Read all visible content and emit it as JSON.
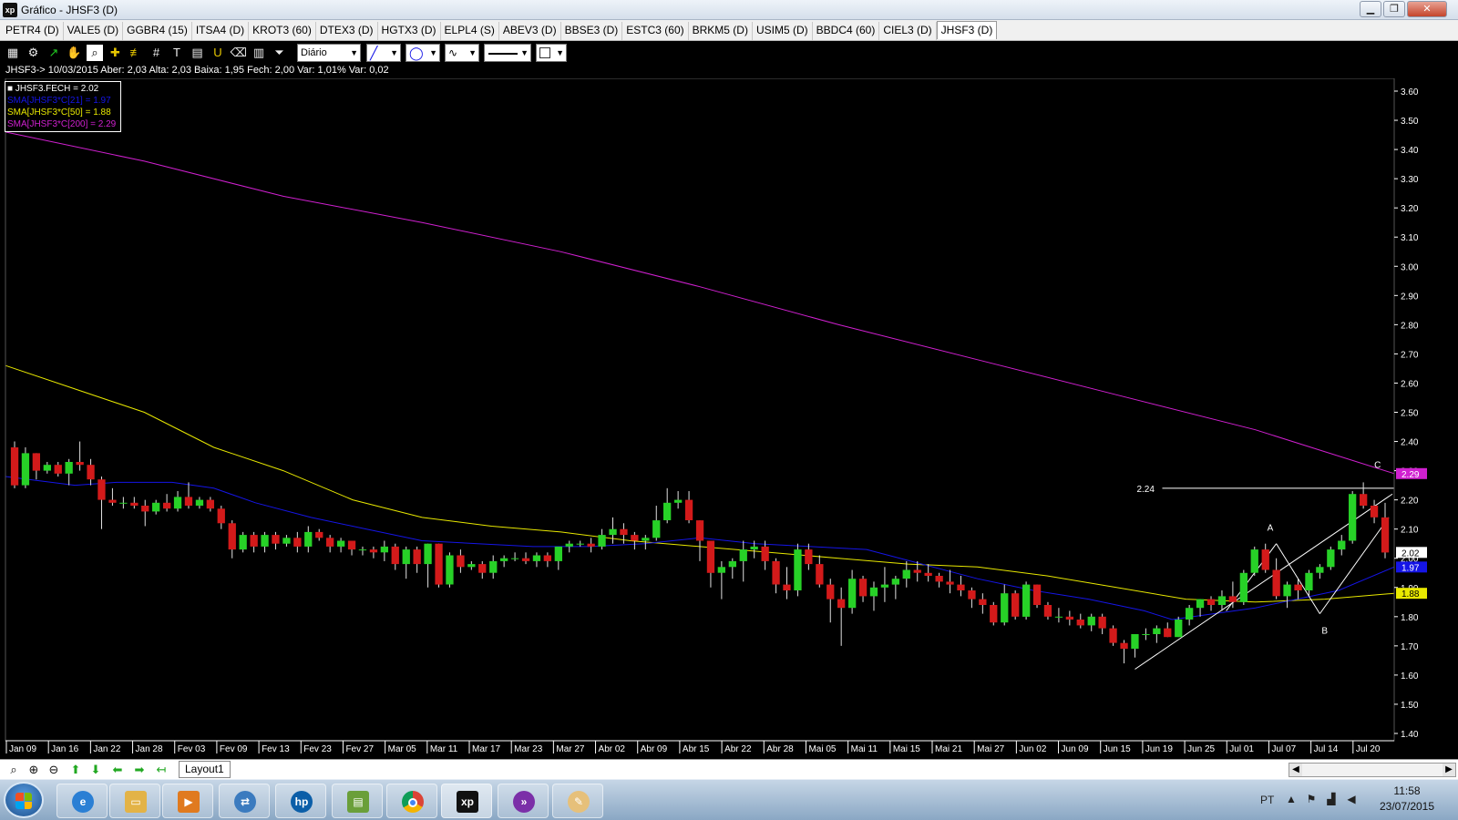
{
  "window": {
    "logo": "xp",
    "title": "Gráfico - JHSF3 (D)",
    "controls": [
      "▁",
      "❐",
      "✕"
    ]
  },
  "tabs": [
    {
      "label": "PETR4 (D)"
    },
    {
      "label": "VALE5 (D)"
    },
    {
      "label": "GGBR4 (15)"
    },
    {
      "label": "ITSA4 (D)"
    },
    {
      "label": "KROT3 (60)"
    },
    {
      "label": "DTEX3 (D)"
    },
    {
      "label": "HGTX3 (D)"
    },
    {
      "label": "ELPL4 (S)"
    },
    {
      "label": "ABEV3 (D)"
    },
    {
      "label": "BBSE3 (D)"
    },
    {
      "label": "ESTC3 (60)"
    },
    {
      "label": "BRKM5 (D)"
    },
    {
      "label": "USIM5 (D)"
    },
    {
      "label": "BBDC4 (60)"
    },
    {
      "label": "CIEL3 (D)"
    },
    {
      "label": "JHSF3 (D)",
      "active": true
    }
  ],
  "toolbar": {
    "icons": [
      "chart-icon",
      "gear-icon",
      "line-tool-icon",
      "hand-icon",
      "zoom-fit-icon",
      "crosshair-icon",
      "parallel-lines-icon",
      "grid-icon",
      "text-icon",
      "calculator-icon",
      "magnet-icon",
      "eraser-icon",
      "trash-icon",
      "filter-icon"
    ],
    "period": "Diário"
  },
  "info": {
    "line": "JHSF3-> 10/03/2015 Aber: 2,03 Alta: 2,03 Baixa: 1,95 Fech: 2,00 Var: 1,01% Var: 0,02"
  },
  "legend": [
    {
      "text": "JHSF3.FECH = 2.02",
      "color": "#ffffff"
    },
    {
      "text": "SMA[JHSF3*C[21] = 1.97",
      "color": "#1515e6"
    },
    {
      "text": "SMA[JHSF3*C[50] = 1.88",
      "color": "#e8e800"
    },
    {
      "text": "SMA[JHSF3*C[200] = 2.29",
      "color": "#d020d0"
    }
  ],
  "chart_data": {
    "type": "candlestick",
    "ylim": [
      1.4,
      3.66
    ],
    "y_ticks": [
      "3.60",
      "3.50",
      "3.40",
      "3.30",
      "3.20",
      "3.10",
      "3.00",
      "2.90",
      "2.80",
      "2.70",
      "2.60",
      "2.50",
      "2.40",
      "2.30",
      "2.20",
      "2.10",
      "2.00",
      "1.90",
      "1.80",
      "1.70",
      "1.60",
      "1.50",
      "1.40"
    ],
    "x_labels": [
      "Jan 09",
      "Jan 16",
      "Jan 22",
      "Jan 28",
      "Fev 03",
      "Fev 09",
      "Fev 13",
      "Fev 23",
      "Fev 27",
      "Mar 05",
      "Mar 11",
      "Mar 17",
      "Mar 23",
      "Mar 27",
      "Abr 02",
      "Abr 09",
      "Abr 15",
      "Abr 22",
      "Abr 28",
      "Mai 05",
      "Mai 11",
      "Mai 15",
      "Mai 21",
      "Mai 27",
      "Jun 02",
      "Jun 09",
      "Jun 15",
      "Jun 19",
      "Jun 25",
      "Jul 01",
      "Jul 07",
      "Jul 14",
      "Jul 20"
    ],
    "candles": [
      [
        2.38,
        2.4,
        2.24,
        2.25
      ],
      [
        2.25,
        2.38,
        2.24,
        2.36
      ],
      [
        2.36,
        2.36,
        2.27,
        2.3
      ],
      [
        2.3,
        2.33,
        2.29,
        2.32
      ],
      [
        2.32,
        2.33,
        2.28,
        2.29
      ],
      [
        2.29,
        2.34,
        2.25,
        2.33
      ],
      [
        2.33,
        2.4,
        2.3,
        2.32
      ],
      [
        2.32,
        2.34,
        2.25,
        2.27
      ],
      [
        2.27,
        2.28,
        2.1,
        2.2
      ],
      [
        2.2,
        2.24,
        2.18,
        2.19
      ],
      [
        2.19,
        2.21,
        2.17,
        2.19
      ],
      [
        2.19,
        2.21,
        2.17,
        2.18
      ],
      [
        2.18,
        2.2,
        2.11,
        2.16
      ],
      [
        2.16,
        2.2,
        2.15,
        2.19
      ],
      [
        2.19,
        2.22,
        2.16,
        2.17
      ],
      [
        2.17,
        2.23,
        2.16,
        2.21
      ],
      [
        2.21,
        2.26,
        2.17,
        2.18
      ],
      [
        2.18,
        2.21,
        2.17,
        2.2
      ],
      [
        2.2,
        2.21,
        2.16,
        2.17
      ],
      [
        2.17,
        2.18,
        2.1,
        2.12
      ],
      [
        2.12,
        2.13,
        2.0,
        2.03
      ],
      [
        2.03,
        2.09,
        2.02,
        2.08
      ],
      [
        2.08,
        2.09,
        2.02,
        2.04
      ],
      [
        2.04,
        2.09,
        2.02,
        2.08
      ],
      [
        2.08,
        2.09,
        2.03,
        2.05
      ],
      [
        2.05,
        2.08,
        2.04,
        2.07
      ],
      [
        2.07,
        2.09,
        2.02,
        2.04
      ],
      [
        2.04,
        2.11,
        2.02,
        2.09
      ],
      [
        2.09,
        2.1,
        2.06,
        2.07
      ],
      [
        2.07,
        2.08,
        2.02,
        2.04
      ],
      [
        2.04,
        2.07,
        2.02,
        2.06
      ],
      [
        2.06,
        2.06,
        2.01,
        2.03
      ],
      [
        2.03,
        2.04,
        2.01,
        2.03
      ],
      [
        2.03,
        2.04,
        2.0,
        2.02
      ],
      [
        2.02,
        2.06,
        1.99,
        2.04
      ],
      [
        2.04,
        2.05,
        1.96,
        1.98
      ],
      [
        1.98,
        2.04,
        1.93,
        2.03
      ],
      [
        2.03,
        2.04,
        1.95,
        1.98
      ],
      [
        1.98,
        2.05,
        1.9,
        2.05
      ],
      [
        2.05,
        2.05,
        1.9,
        1.91
      ],
      [
        1.91,
        2.02,
        1.9,
        2.01
      ],
      [
        2.01,
        2.03,
        1.95,
        1.97
      ],
      [
        1.97,
        1.99,
        1.96,
        1.98
      ],
      [
        1.98,
        1.99,
        1.93,
        1.95
      ],
      [
        1.95,
        2.01,
        1.93,
        1.99
      ],
      [
        1.99,
        2.01,
        1.97,
        2.0
      ],
      [
        2.0,
        2.02,
        1.99,
        2.0
      ],
      [
        2.0,
        2.02,
        1.98,
        1.99
      ],
      [
        1.99,
        2.02,
        1.97,
        2.01
      ],
      [
        2.01,
        2.02,
        1.97,
        1.99
      ],
      [
        1.99,
        2.02,
        1.96,
        2.04
      ],
      [
        2.04,
        2.06,
        2.02,
        2.05
      ],
      [
        2.05,
        2.06,
        2.04,
        2.05
      ],
      [
        2.05,
        2.07,
        2.02,
        2.04
      ],
      [
        2.04,
        2.1,
        2.03,
        2.08
      ],
      [
        2.08,
        2.14,
        2.05,
        2.1
      ],
      [
        2.1,
        2.12,
        2.05,
        2.08
      ],
      [
        2.08,
        2.09,
        2.03,
        2.06
      ],
      [
        2.06,
        2.08,
        2.03,
        2.07
      ],
      [
        2.07,
        2.18,
        2.06,
        2.13
      ],
      [
        2.13,
        2.24,
        2.12,
        2.19
      ],
      [
        2.19,
        2.23,
        2.17,
        2.2
      ],
      [
        2.2,
        2.23,
        2.12,
        2.13
      ],
      [
        2.13,
        2.13,
        1.99,
        2.06
      ],
      [
        2.06,
        2.06,
        1.9,
        1.95
      ],
      [
        1.95,
        1.99,
        1.86,
        1.97
      ],
      [
        1.97,
        2.0,
        1.93,
        1.99
      ],
      [
        1.99,
        2.06,
        1.92,
        2.03
      ],
      [
        2.03,
        2.06,
        2.0,
        2.04
      ],
      [
        2.04,
        2.06,
        1.96,
        1.99
      ],
      [
        1.99,
        2.0,
        1.88,
        1.91
      ],
      [
        1.91,
        1.97,
        1.86,
        1.89
      ],
      [
        1.89,
        2.05,
        1.87,
        2.03
      ],
      [
        2.03,
        2.05,
        1.96,
        1.98
      ],
      [
        1.98,
        2.01,
        1.9,
        1.91
      ],
      [
        1.91,
        1.93,
        1.78,
        1.86
      ],
      [
        1.86,
        1.9,
        1.7,
        1.83
      ],
      [
        1.83,
        1.96,
        1.81,
        1.93
      ],
      [
        1.93,
        1.94,
        1.85,
        1.87
      ],
      [
        1.87,
        1.92,
        1.82,
        1.9
      ],
      [
        1.9,
        1.97,
        1.85,
        1.91
      ],
      [
        1.91,
        1.94,
        1.86,
        1.93
      ],
      [
        1.93,
        1.99,
        1.9,
        1.96
      ],
      [
        1.96,
        1.99,
        1.92,
        1.95
      ],
      [
        1.95,
        1.98,
        1.92,
        1.94
      ],
      [
        1.94,
        1.95,
        1.9,
        1.92
      ],
      [
        1.92,
        1.96,
        1.88,
        1.91
      ],
      [
        1.91,
        1.94,
        1.87,
        1.89
      ],
      [
        1.89,
        1.9,
        1.83,
        1.86
      ],
      [
        1.86,
        1.88,
        1.81,
        1.84
      ],
      [
        1.84,
        1.85,
        1.77,
        1.78
      ],
      [
        1.78,
        1.91,
        1.77,
        1.88
      ],
      [
        1.88,
        1.89,
        1.79,
        1.8
      ],
      [
        1.8,
        1.92,
        1.79,
        1.91
      ],
      [
        1.91,
        1.91,
        1.83,
        1.84
      ],
      [
        1.84,
        1.85,
        1.79,
        1.8
      ],
      [
        1.8,
        1.83,
        1.78,
        1.8
      ],
      [
        1.8,
        1.82,
        1.77,
        1.79
      ],
      [
        1.79,
        1.81,
        1.76,
        1.77
      ],
      [
        1.77,
        1.81,
        1.75,
        1.8
      ],
      [
        1.8,
        1.81,
        1.74,
        1.76
      ],
      [
        1.76,
        1.77,
        1.7,
        1.71
      ],
      [
        1.71,
        1.72,
        1.64,
        1.69
      ],
      [
        1.69,
        1.74,
        1.66,
        1.74
      ],
      [
        1.74,
        1.76,
        1.72,
        1.74
      ],
      [
        1.74,
        1.77,
        1.71,
        1.76
      ],
      [
        1.76,
        1.78,
        1.73,
        1.73
      ],
      [
        1.73,
        1.8,
        1.73,
        1.79
      ],
      [
        1.79,
        1.84,
        1.77,
        1.83
      ],
      [
        1.83,
        1.86,
        1.8,
        1.86
      ],
      [
        1.86,
        1.87,
        1.82,
        1.84
      ],
      [
        1.84,
        1.89,
        1.82,
        1.87
      ],
      [
        1.87,
        1.92,
        1.83,
        1.85
      ],
      [
        1.85,
        1.96,
        1.84,
        1.95
      ],
      [
        1.95,
        2.04,
        1.94,
        2.03
      ],
      [
        2.03,
        2.05,
        1.95,
        1.96
      ],
      [
        1.96,
        2.0,
        1.86,
        1.87
      ],
      [
        1.87,
        1.92,
        1.83,
        1.91
      ],
      [
        1.91,
        1.93,
        1.86,
        1.89
      ],
      [
        1.89,
        1.96,
        1.87,
        1.95
      ],
      [
        1.95,
        1.98,
        1.93,
        1.97
      ],
      [
        1.97,
        2.04,
        1.96,
        2.03
      ],
      [
        2.03,
        2.08,
        2.01,
        2.06
      ],
      [
        2.06,
        2.23,
        2.05,
        2.22
      ],
      [
        2.22,
        2.26,
        2.17,
        2.18
      ],
      [
        2.18,
        2.2,
        2.12,
        2.14
      ],
      [
        2.14,
        2.19,
        2.0,
        2.02
      ]
    ],
    "sma200": [
      [
        0,
        3.46
      ],
      [
        0.1,
        3.36
      ],
      [
        0.2,
        3.24
      ],
      [
        0.3,
        3.15
      ],
      [
        0.4,
        3.05
      ],
      [
        0.5,
        2.93
      ],
      [
        0.6,
        2.8
      ],
      [
        0.7,
        2.68
      ],
      [
        0.8,
        2.56
      ],
      [
        0.9,
        2.44
      ],
      [
        1.0,
        2.29
      ]
    ],
    "sma50": [
      [
        0,
        2.66
      ],
      [
        0.05,
        2.58
      ],
      [
        0.1,
        2.5
      ],
      [
        0.15,
        2.38
      ],
      [
        0.2,
        2.3
      ],
      [
        0.25,
        2.2
      ],
      [
        0.3,
        2.14
      ],
      [
        0.35,
        2.11
      ],
      [
        0.4,
        2.09
      ],
      [
        0.45,
        2.06
      ],
      [
        0.5,
        2.04
      ],
      [
        0.55,
        2.02
      ],
      [
        0.6,
        2.0
      ],
      [
        0.65,
        1.98
      ],
      [
        0.7,
        1.97
      ],
      [
        0.75,
        1.94
      ],
      [
        0.8,
        1.9
      ],
      [
        0.85,
        1.86
      ],
      [
        0.9,
        1.85
      ],
      [
        0.95,
        1.86
      ],
      [
        1.0,
        1.88
      ]
    ],
    "sma21": [
      [
        0,
        2.28
      ],
      [
        0.05,
        2.25
      ],
      [
        0.08,
        2.26
      ],
      [
        0.12,
        2.26
      ],
      [
        0.15,
        2.24
      ],
      [
        0.18,
        2.19
      ],
      [
        0.22,
        2.14
      ],
      [
        0.26,
        2.1
      ],
      [
        0.3,
        2.06
      ],
      [
        0.34,
        2.05
      ],
      [
        0.38,
        2.04
      ],
      [
        0.42,
        2.04
      ],
      [
        0.46,
        2.05
      ],
      [
        0.5,
        2.07
      ],
      [
        0.54,
        2.05
      ],
      [
        0.58,
        2.04
      ],
      [
        0.62,
        2.03
      ],
      [
        0.66,
        1.98
      ],
      [
        0.7,
        1.93
      ],
      [
        0.74,
        1.89
      ],
      [
        0.78,
        1.86
      ],
      [
        0.82,
        1.82
      ],
      [
        0.84,
        1.79
      ],
      [
        0.87,
        1.81
      ],
      [
        0.9,
        1.83
      ],
      [
        0.93,
        1.86
      ],
      [
        0.96,
        1.89
      ],
      [
        1.0,
        1.97
      ]
    ],
    "resistance": {
      "value": 2.24,
      "label": "2.24"
    },
    "points": [
      {
        "label": "A",
        "value": 2.05
      },
      {
        "label": "B",
        "value": 1.81
      },
      {
        "label": "C",
        "value": 2.26
      }
    ],
    "price_tags": [
      {
        "text": "2.29",
        "value": 2.29,
        "bg": "#d020d0",
        "fg": "#ffffff"
      },
      {
        "text": "2.02",
        "value": 2.02,
        "bg": "#ffffff",
        "fg": "#000000"
      },
      {
        "text": "1.97",
        "value": 1.97,
        "bg": "#1515e6",
        "fg": "#ffffff"
      },
      {
        "text": "1.88",
        "value": 1.88,
        "bg": "#e8e800",
        "fg": "#000000"
      }
    ],
    "colors": {
      "up": "#27d127",
      "down": "#d31a1a",
      "wick": "#e0e0e0",
      "sma200": "#d020d0",
      "sma50": "#e8e800",
      "sma21": "#1515e6",
      "grid_text": "#ffffff"
    }
  },
  "bottombar": {
    "icons": [
      "zoom-icon",
      "zoom-in-icon",
      "zoom-out-icon",
      "arrow-up-icon",
      "arrow-down-icon",
      "arrow-left-icon",
      "arrow-right-icon",
      "arrow-end-icon"
    ],
    "layout_tab": "Layout1"
  },
  "taskbar": {
    "apps": [
      "ie-icon",
      "explorer-icon",
      "media-icon",
      "network-icon",
      "hp-icon",
      "files-icon",
      "chrome-icon",
      "xp-icon",
      "forward-icon",
      "paint-icon"
    ],
    "xp_label": "xp",
    "hp_label": "hp",
    "language": "PT",
    "time": "11:58",
    "date": "23/07/2015"
  }
}
